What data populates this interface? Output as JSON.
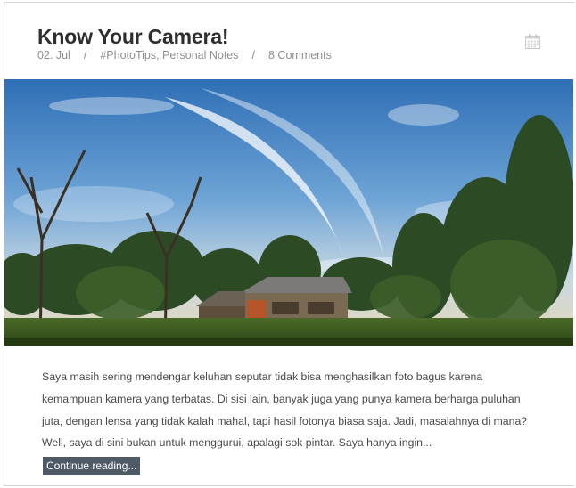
{
  "post": {
    "title": "Know Your Camera!",
    "meta": {
      "date": "02. Jul",
      "separator": "/",
      "categories": "#PhotoTips, Personal Notes",
      "comments": "8 Comments"
    },
    "image_alt": "Wooden house among trees under a sky with wispy clouds",
    "excerpt": "Saya masih sering mendengar keluhan seputar tidak bisa menghasilkan foto bagus karena kemampuan kamera yang terbatas. Di sisi lain, banyak juga yang punya kamera berharga puluhan juta, dengan lensa yang tidak kalah mahal, tapi hasil fotonya biasa saja. Jadi, masalahnya di mana? Well, saya di sini bukan untuk menggurui, apalagi sok pintar. Saya hanya ingin...",
    "continue_label": "Continue reading...",
    "icon": "calendar-icon"
  },
  "colors": {
    "title": "#2e2e2e",
    "meta": "#8e8e8e",
    "text": "#4a4a4a",
    "button_bg": "#4e5a66"
  }
}
